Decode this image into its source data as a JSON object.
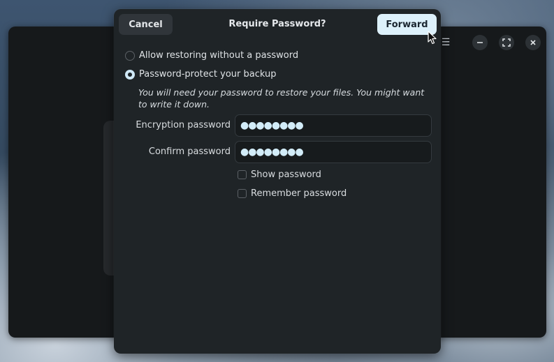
{
  "dialog": {
    "title": "Require Password?",
    "cancel_label": "Cancel",
    "forward_label": "Forward"
  },
  "options": {
    "no_password_label": "Allow restoring without a password",
    "protect_label": "Password-protect your backup",
    "selected": "protect"
  },
  "note": "You will need your password to restore your files. You might want to write it down.",
  "fields": {
    "encryption_label": "Encryption password",
    "encryption_value": "●●●●●●●●",
    "confirm_label": "Confirm password",
    "confirm_value": "●●●●●●●●"
  },
  "checks": {
    "show_label": "Show password",
    "show_checked": false,
    "remember_label": "Remember password",
    "remember_checked": false
  },
  "icons": {
    "menu": "hamburger-icon",
    "minimize": "minimize-icon",
    "maximize": "maximize-icon",
    "close": "close-icon"
  },
  "colors": {
    "accent": "#ddf1fb",
    "dialog_bg": "#1f2427"
  }
}
